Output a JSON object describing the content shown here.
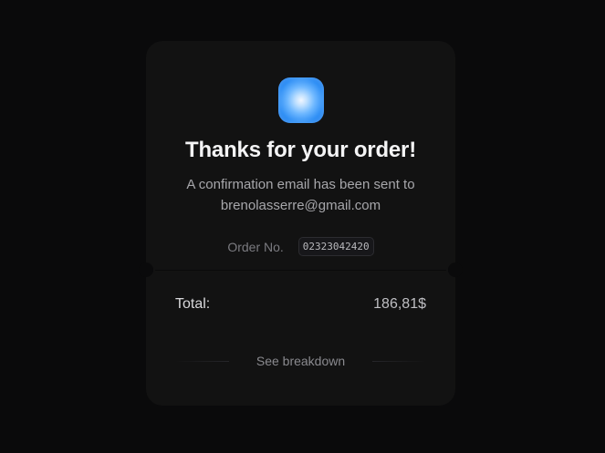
{
  "confirmation": {
    "icon": "app-icon",
    "title": "Thanks for your order!",
    "subtitle_line1": "A confirmation email has been sent to",
    "email": "brenolasserre@gmail.com",
    "order_label": "Order No.",
    "order_number": "02323042420"
  },
  "summary": {
    "total_label": "Total:",
    "total_value": "186,81$",
    "breakdown_label": "See breakdown"
  },
  "colors": {
    "background": "#0a0a0b",
    "card": "#121212",
    "accent": "#2f8ff5"
  }
}
